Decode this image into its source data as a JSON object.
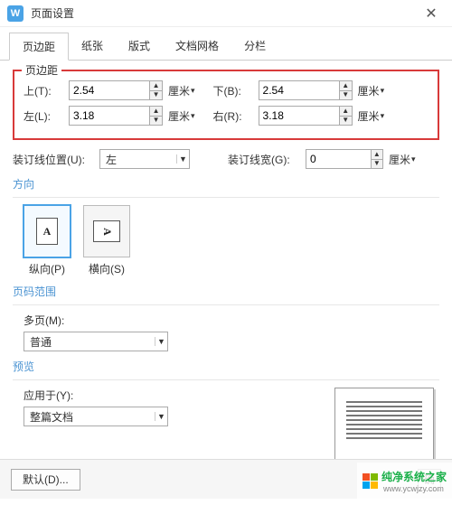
{
  "window": {
    "title": "页面设置",
    "logo_letter": "W"
  },
  "tabs": {
    "t1": "页边距",
    "t2": "纸张",
    "t3": "版式",
    "t4": "文档网格",
    "t5": "分栏"
  },
  "margins": {
    "legend": "页边距",
    "top_label": "上(T):",
    "top_value": "2.54",
    "bottom_label": "下(B):",
    "bottom_value": "2.54",
    "left_label": "左(L):",
    "left_value": "3.18",
    "right_label": "右(R):",
    "right_value": "3.18",
    "unit": "厘米"
  },
  "gutter": {
    "pos_label": "装订线位置(U):",
    "pos_value": "左",
    "width_label": "装订线宽(G):",
    "width_value": "0",
    "unit": "厘米"
  },
  "orientation": {
    "title": "方向",
    "portrait": "纵向(P)",
    "landscape": "横向(S)"
  },
  "pagerange": {
    "title": "页码范围",
    "multi_label": "多页(M):",
    "multi_value": "普通"
  },
  "preview": {
    "title": "预览",
    "apply_label": "应用于(Y):",
    "apply_value": "整篇文档"
  },
  "footer": {
    "default_btn": "默认(D)..."
  },
  "watermark": {
    "text": "纯净系统之家",
    "url": "www.ycwjzy.com"
  }
}
